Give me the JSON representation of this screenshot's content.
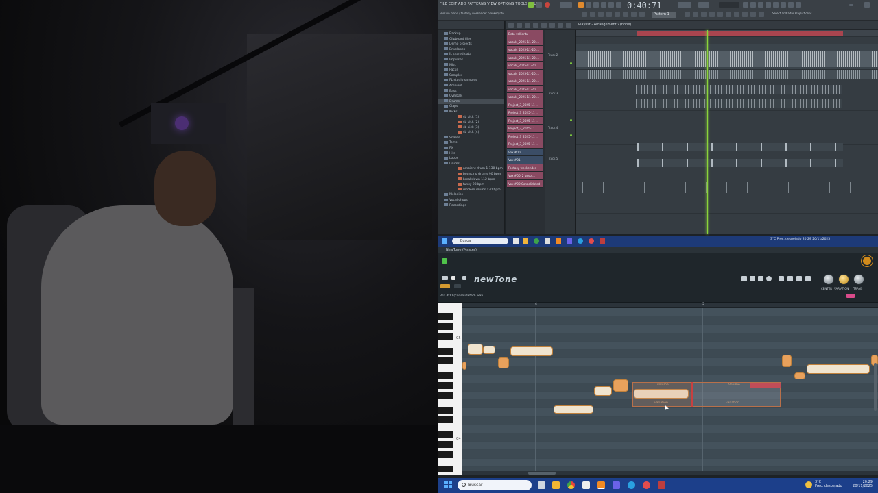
{
  "fl": {
    "menu": "FILE  EDIT  ADD  PATTERNS  VIEW  OPTIONS  TOOLS  HELP",
    "song_info": "Version blanc / fantasy weekender blanket/info",
    "time": "0:40:71",
    "pattern": "Pattern 1",
    "hint": "Select and alter Playlist clips",
    "playlist_title": "Playlist - Arrangement  › (none)",
    "browser": [
      {
        "label": "Backup",
        "type": "folder"
      },
      {
        "label": "Clipboard files",
        "type": "folder"
      },
      {
        "label": "Demo projects",
        "type": "folder"
      },
      {
        "label": "Envelopes",
        "type": "folder"
      },
      {
        "label": "IL shared data",
        "type": "folder"
      },
      {
        "label": "Impulses",
        "type": "folder"
      },
      {
        "label": "Misc",
        "type": "folder"
      },
      {
        "label": "Packs",
        "type": "folder"
      },
      {
        "label": "Samples",
        "type": "folder"
      },
      {
        "label": "FL studio samples",
        "type": "folder"
      },
      {
        "label": "Ambient",
        "type": "folder"
      },
      {
        "label": "Bass",
        "type": "folder"
      },
      {
        "label": "Cymbals",
        "type": "folder"
      },
      {
        "label": "Drums",
        "type": "folder",
        "selected": true
      },
      {
        "label": "Claps",
        "type": "folder"
      },
      {
        "label": "Kicks",
        "type": "folder"
      },
      {
        "label": "sb kick (1)",
        "type": "wav"
      },
      {
        "label": "sb kick (2)",
        "type": "wav"
      },
      {
        "label": "sb kick (3)",
        "type": "wav"
      },
      {
        "label": "sb kick (4)",
        "type": "wav"
      },
      {
        "label": "Snares",
        "type": "folder"
      },
      {
        "label": "Toms",
        "type": "folder"
      },
      {
        "label": "FX",
        "type": "folder"
      },
      {
        "label": "Hits",
        "type": "folder"
      },
      {
        "label": "Loops",
        "type": "folder"
      },
      {
        "label": "Drums",
        "type": "folder"
      },
      {
        "label": "ambient drum 1 130 bpm",
        "type": "wav"
      },
      {
        "label": "bouncing drums 90 bpm",
        "type": "wav"
      },
      {
        "label": "breakdown 112 bpm",
        "type": "wav"
      },
      {
        "label": "funky 98 bpm",
        "type": "wav"
      },
      {
        "label": "modern drums 120 bpm",
        "type": "wav"
      },
      {
        "label": "Melodies",
        "type": "folder"
      },
      {
        "label": "Vocal chops",
        "type": "folder"
      },
      {
        "label": "Recordings",
        "type": "folder"
      }
    ],
    "clips": [
      {
        "label": "Beta vallienta",
        "style": "sel"
      },
      {
        "label": "vocals_2025-11-20 ...",
        "style": "sel"
      },
      {
        "label": "vocals_2025-11-20 ...",
        "style": "sel"
      },
      {
        "label": "vocals_2025-11-20 ...",
        "style": "sel"
      },
      {
        "label": "vocals_2025-11-20 ...",
        "style": "sel"
      },
      {
        "label": "vocals_2025-11-20 ...",
        "style": "sel"
      },
      {
        "label": "vocals_2025-11-20 ...",
        "style": "sel"
      },
      {
        "label": "vocals_2025-11-20 ...",
        "style": "sel"
      },
      {
        "label": "vocals_2025-11-20 ...",
        "style": "sel"
      },
      {
        "label": "Project_3_2025-11 ...",
        "style": "sel"
      },
      {
        "label": "Project_3_2025-11 ...",
        "style": "sel"
      },
      {
        "label": "Project_3_2025-11 ...",
        "style": "sel"
      },
      {
        "label": "Project_3_2025-11 ...",
        "style": "sel"
      },
      {
        "label": "Project_3_2025-11 ...",
        "style": "sel"
      },
      {
        "label": "Project_3_2025-11 ...",
        "style": "sel"
      },
      {
        "label": "Vox #00",
        "style": "dark"
      },
      {
        "label": "Vox #01",
        "style": "dark"
      },
      {
        "label": "Fantasy weekender",
        "style": "sel"
      },
      {
        "label": "Vox #00_2 unsol...",
        "style": "sel"
      },
      {
        "label": "Vox #00 Consolidated",
        "style": "sel"
      }
    ],
    "tracks": [
      "Track 2",
      "Track 3",
      "Track 4",
      "Track 5"
    ]
  },
  "taskbar_inner": {
    "search": "Buscar",
    "tray": "3°C  Prec. despejado     20:29  20/11/2025"
  },
  "newtone": {
    "window_title": "NewTone (Master)",
    "logo": "newTone",
    "file": "Vox #00 (consolidated).wav",
    "knob_labels": [
      "CENTER",
      "VARIATION",
      "TRANS"
    ],
    "bar_numbers": [
      "4",
      "5"
    ],
    "note_labels": [
      "C5",
      "C4"
    ],
    "block_labels": {
      "volume_a": "volume",
      "variation_a": "variation",
      "volume_b": "Volume",
      "variation_b": "variation"
    }
  },
  "taskbar": {
    "search": "Buscar",
    "weather_temp": "3°C",
    "weather_desc": "Prec. despejado",
    "time": "20:29",
    "date": "20/11/2025"
  }
}
